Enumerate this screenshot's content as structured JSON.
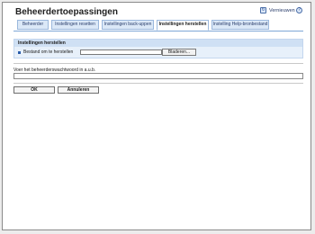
{
  "app": {
    "title": "Beheerdertoepassingen",
    "refresh_label": "Vernieuwen"
  },
  "tabs": [
    {
      "label": "Beheerder"
    },
    {
      "label": "Instellingen resetten"
    },
    {
      "label": "Instellingen back-uppen"
    },
    {
      "label": "Instellingen herstellen",
      "active": true
    },
    {
      "label": "Instelling Help-bronbestand"
    }
  ],
  "restore_section": {
    "title": "Instellingen herstellen",
    "file_label": "Bestand om te herstellen",
    "file_value": "",
    "browse_label": "Bladeren..."
  },
  "password": {
    "label": "Voer het beheerderswachtwoord in a.u.b.",
    "value": ""
  },
  "actions": {
    "ok_label": "OK",
    "cancel_label": "Annuleren"
  }
}
